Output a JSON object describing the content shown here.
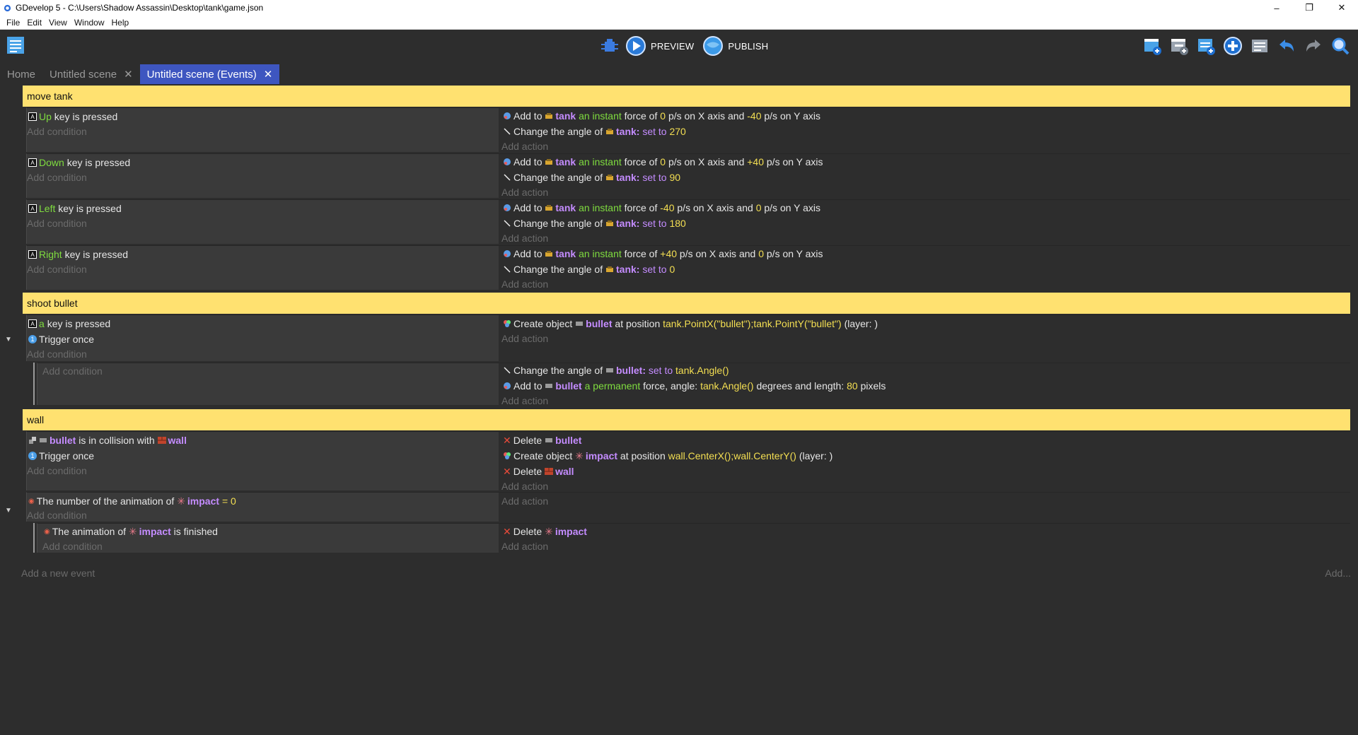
{
  "window": {
    "title": "GDevelop 5 - C:\\Users\\Shadow Assassin\\Desktop\\tank\\game.json"
  },
  "menu": [
    "File",
    "Edit",
    "View",
    "Window",
    "Help"
  ],
  "toolbar": {
    "preview_label": "PREVIEW",
    "publish_label": "PUBLISH"
  },
  "tabs": [
    {
      "label": "Home"
    },
    {
      "label": "Untitled scene"
    },
    {
      "label": "Untitled scene (Events)"
    }
  ],
  "common": {
    "add_condition": "Add condition",
    "add_action": "Add action"
  },
  "groups": {
    "g1": "move tank",
    "g2": "shoot bullet",
    "g3": "wall"
  },
  "ev_up": {
    "cond": {
      "key": "Up",
      "rest": "key is pressed"
    },
    "act1": {
      "a": "Add to",
      "obj": "tank",
      "mode": "an instant",
      "b": "force of",
      "x": "0",
      "c": "p/s on X axis and",
      "y": "-40",
      "d": "p/s on Y axis"
    },
    "act2": {
      "a": "Change the angle of",
      "obj": "tank:",
      "op": "set to",
      "val": "270"
    }
  },
  "ev_down": {
    "cond": {
      "key": "Down",
      "rest": "key is pressed"
    },
    "act1": {
      "a": "Add to",
      "obj": "tank",
      "mode": "an instant",
      "b": "force of",
      "x": "0",
      "c": "p/s on X axis and",
      "y": "+40",
      "d": "p/s on Y axis"
    },
    "act2": {
      "a": "Change the angle of",
      "obj": "tank:",
      "op": "set to",
      "val": "90"
    }
  },
  "ev_left": {
    "cond": {
      "key": "Left",
      "rest": "key is pressed"
    },
    "act1": {
      "a": "Add to",
      "obj": "tank",
      "mode": "an instant",
      "b": "force of",
      "x": "-40",
      "c": "p/s on X axis and",
      "y": "0",
      "d": "p/s on Y axis"
    },
    "act2": {
      "a": "Change the angle of",
      "obj": "tank:",
      "op": "set to",
      "val": "180"
    }
  },
  "ev_right": {
    "cond": {
      "key": "Right",
      "rest": "key is pressed"
    },
    "act1": {
      "a": "Add to",
      "obj": "tank",
      "mode": "an instant",
      "b": "force of",
      "x": "+40",
      "c": "p/s on X axis and",
      "y": "0",
      "d": "p/s on Y axis"
    },
    "act2": {
      "a": "Change the angle of",
      "obj": "tank:",
      "op": "set to",
      "val": "0"
    }
  },
  "ev_shoot": {
    "cond1": {
      "key": "a",
      "rest": "key is pressed"
    },
    "cond2": "Trigger once",
    "act1": {
      "a": "Create object",
      "obj": "bullet",
      "b": "at position",
      "expr": "tank.PointX(\"bullet\");tank.PointY(\"bullet\")",
      "c": "(layer: )"
    },
    "sub_act1": {
      "a": "Change the angle of",
      "obj": "bullet:",
      "op": "set to",
      "val": "tank.Angle()"
    },
    "sub_act2": {
      "a": "Add to",
      "obj": "bullet",
      "mode": "a permanent",
      "b": "force, angle:",
      "ang": "tank.Angle()",
      "c": "degrees and length:",
      "len": "80",
      "d": "pixels"
    }
  },
  "ev_wall": {
    "cond1": {
      "obj1": "bullet",
      "a": "is in collision with",
      "obj2": "wall"
    },
    "cond2": "Trigger once",
    "act1": {
      "a": "Delete",
      "obj": "bullet"
    },
    "act2": {
      "a": "Create object",
      "obj": "impact",
      "b": "at position",
      "expr": "wall.CenterX();wall.CenterY()",
      "c": "(layer: )"
    },
    "act3": {
      "a": "Delete",
      "obj": "wall"
    }
  },
  "ev_anim": {
    "cond": {
      "a": "The number of the animation of",
      "obj": "impact",
      "op": "=",
      "val": "0"
    },
    "sub_cond": {
      "a": "The animation of",
      "obj": "impact",
      "b": "is finished"
    },
    "sub_act": {
      "a": "Delete",
      "obj": "impact"
    }
  },
  "footer": {
    "add_event": "Add a new event",
    "add_more": "Add..."
  },
  "colors": {
    "group_bar": "#ffe170",
    "tab_active": "#3e56c0",
    "object": "#c48cff",
    "value": "#f4df52",
    "keyword": "#7fdc3f"
  }
}
